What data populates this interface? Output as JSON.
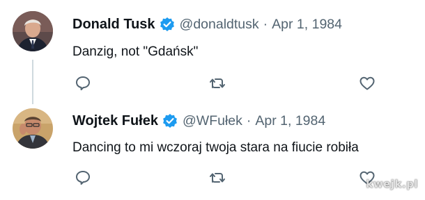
{
  "tweets": [
    {
      "name": "Donald Tusk",
      "handle": "@donaldtusk",
      "separator": "·",
      "date": "Apr 1, 1984",
      "text": "Danzig, not \"Gdańsk\"",
      "verified": true,
      "avatar_icon": "avatar-donald-tusk"
    },
    {
      "name": "Wojtek Fułek",
      "handle": "@WFułek",
      "separator": "·",
      "date": "Apr 1, 1984",
      "text": "Dancing to mi wczoraj twoja stara na fiucie robiła",
      "verified": true,
      "avatar_icon": "avatar-wojtek-fulek"
    }
  ],
  "actions": [
    "reply-icon",
    "retweet-icon",
    "like-icon"
  ],
  "watermark": "kwejk.pl",
  "colors": {
    "verified_blue": "#1d9bf0",
    "secondary_text": "#536471",
    "primary_text": "#0f1419",
    "thread_line": "#cfd9de"
  }
}
